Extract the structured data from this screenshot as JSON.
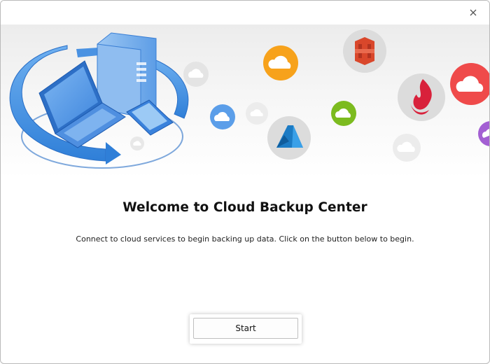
{
  "window": {
    "close_icon": "close-icon"
  },
  "hero": {
    "illustration": "computer-backup-illustration",
    "cloud_icons": [
      "cloud-icon-grey",
      "cloud-icon-orange",
      "amazon-s3-icon",
      "backblaze-icon",
      "cloud-icon-red",
      "cloud-icon-blue",
      "cloud-icon-green",
      "azure-icon",
      "cloud-icon-purple"
    ],
    "colors": {
      "orange": "#f7a21b",
      "red": "#ef4a4a",
      "blue": "#5b9ee9",
      "green": "#7cbb1f",
      "purple": "#a35fd3",
      "s3_red": "#d9472b",
      "backblaze_red": "#d8213b",
      "azure_blue": "#1c7bc4"
    }
  },
  "main": {
    "title": "Welcome to Cloud Backup Center",
    "subtitle": "Connect to cloud services to begin backing up data. Click on the button below to begin.",
    "start_label": "Start"
  }
}
